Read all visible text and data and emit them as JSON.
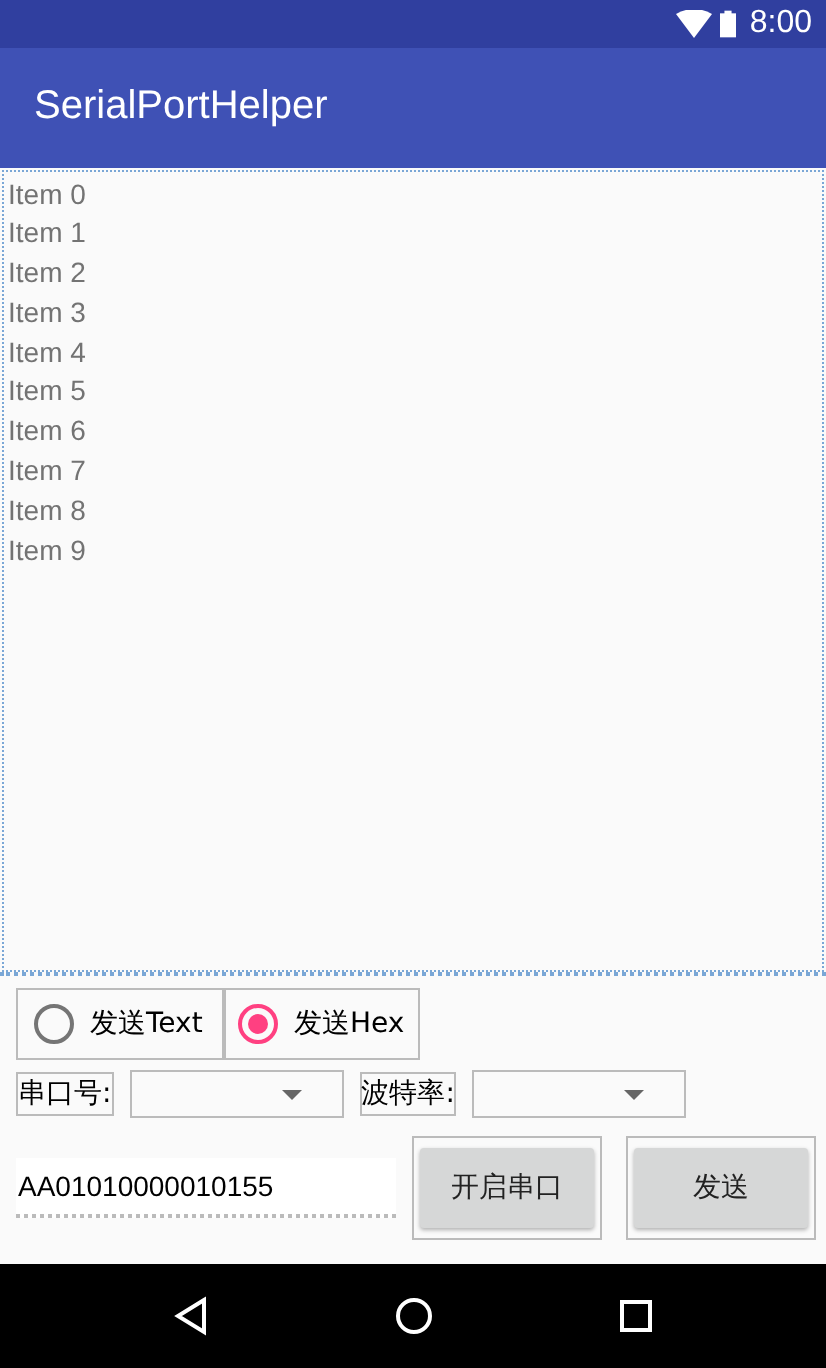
{
  "status_bar": {
    "time": "8:00"
  },
  "app_bar": {
    "title": "SerialPortHelper"
  },
  "list": {
    "items": [
      "Item 0",
      "Item 1",
      "Item 2",
      "Item 3",
      "Item 4",
      "Item 5",
      "Item 6",
      "Item 7",
      "Item 8",
      "Item 9"
    ]
  },
  "send_mode": [
    {
      "label": "发送Text",
      "selected": false
    },
    {
      "label": "发送Hex",
      "selected": true
    }
  ],
  "port": {
    "label": "串口号:"
  },
  "baud": {
    "label": "波特率:"
  },
  "data_field": {
    "value": "AA01010000010155"
  },
  "buttons": [
    {
      "label": "开启串口"
    },
    {
      "label": "发送"
    }
  ]
}
